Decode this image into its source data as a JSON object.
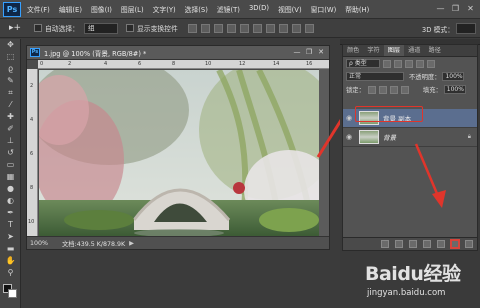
{
  "app": {
    "logo": "Ps"
  },
  "menu": [
    "文件(F)",
    "编辑(E)",
    "图像(I)",
    "图层(L)",
    "文字(Y)",
    "选择(S)",
    "滤镜(T)",
    "3D(D)",
    "视图(V)",
    "窗口(W)",
    "帮助(H)"
  ],
  "window_controls": {
    "minimize": "—",
    "restore": "❐",
    "close": "✕"
  },
  "options_bar": {
    "tool_glyph": "▸+",
    "auto_select_label": "自动选择：",
    "auto_select_value": "组",
    "show_transform_label": "显示变换控件",
    "mode_3d_label": "3D 模式："
  },
  "document": {
    "title": "1.jpg @ 100% (背景, RGB/8#) *",
    "zoom": "100%",
    "info": "文档:439.5 K/878.9K"
  },
  "layers_panel": {
    "tabs": [
      "颜色",
      "字符",
      "图层",
      "通道",
      "路径"
    ],
    "active_tab_index": 2,
    "filter_label": "ρ 类型",
    "blend_mode": "正常",
    "opacity_label": "不透明度：",
    "opacity_value": "100%",
    "lock_label": "锁定：",
    "fill_label": "填充：",
    "fill_value": "100%",
    "layers": [
      {
        "name": "背景 副本",
        "selected": true,
        "italic": false,
        "locked": false
      },
      {
        "name": "背景",
        "selected": false,
        "italic": true,
        "locked": true
      }
    ]
  },
  "watermark": {
    "brand": "Baidu经验",
    "url": "jingyan.baidu.com"
  },
  "colors": {
    "annotation_red": "#e0352b",
    "selected_layer": "#5b6e8f"
  }
}
